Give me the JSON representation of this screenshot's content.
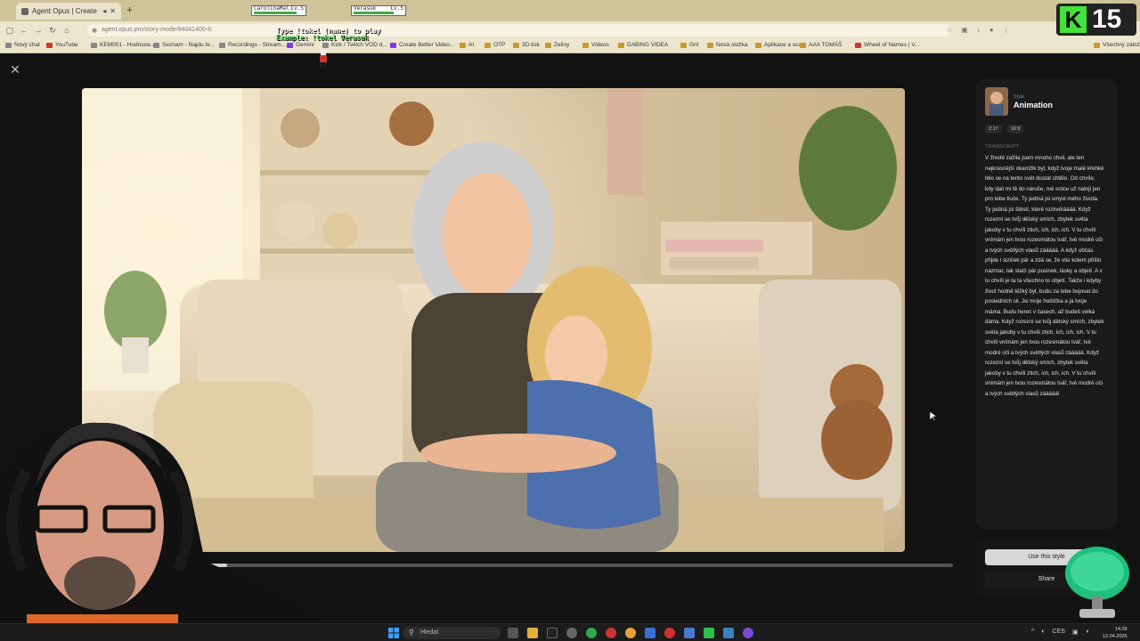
{
  "browser": {
    "tab_title": "Agent Opus | Create video",
    "url": "agent.opus.pro/story-mode/94041400-fc",
    "bookmarks": [
      "Nový chat",
      "YouTube",
      "KEM001 - Hodnoce...",
      "Seznam - Najdu te...",
      "Recordings - Stream...",
      "Gemini",
      "Kick / Twitch VOD d...",
      "Create Better Video...",
      "AI",
      "OTP",
      "3D tisk",
      "Zeliny",
      "Videos",
      "DABING VIDEA",
      "Grit",
      "Nová složka",
      "Aplikace a scan",
      "AAA TOMÁŠ",
      "Wheel of Names | V...",
      "Všechny záložky"
    ]
  },
  "stream": {
    "hp_left_name": "CarolinaMal",
    "hp_left_level": "Lv.5",
    "hp_right_name": "Verasuk",
    "hp_right_level": "Lv.5",
    "hp_left": 0.85,
    "hp_right": 0.8,
    "overlay_line1": "Type !tokel (name) to play",
    "overlay_line2": "Example: !tokel Verasuk",
    "badge_letter": "K",
    "badge_number": "15"
  },
  "panel": {
    "style_label": "Style",
    "style_name": "Animation",
    "duration": "2:17",
    "aspect": "16:9",
    "transcript_heading": "TRANSCRIPT",
    "transcript": "V životě zažila jsem mnoho chvil, ale ten nejkrásnější okamžik byl, když tvoje malé křehké tělo se na tento svět dostat chtělo. Od chvíle, kdy dali mi tě do náruče, mé srdce už nabíjí jen pro tebe tluče. Ty jediná jsi smysl mého života. Ty jediná jsi štěstí, které rozkvétáááá. Když rozezní se tvůj dětský smích, zbytek světa jakoby v tu chvíli ztich, ich, ich, ich. V tu chvíli vnímám jen tvou rozesmátou tvář, tvé modré oči a tvých světlých vlasů zááááá. A když občas přijde i slziček pár a zdá se, že vše kolem přišlo nazmar, tak stačí pár pusinek, lásky a objetí. A v tu chvíli je ta ta všechno to objetí. Takže i kdyby život hodně těžký byl, budu za tebe bojovat do posledních sil. Jsi moje holčička a já tvoje máma. Budu herec v časech, až budeš velká dáma. Když rozezní se tvůj dětský smích, zbytek světa jakoby v tu chvíli ztich, ich, ich, ich. V tu chvíli vnímám jen tvou rozesmátou tvář, tvé modré oči a tvých světlých vlasů zááááá. Když rozezní se tvůj dětský smích, zbytek světa jakoby v tu chvíli ztich, ich, ich, ich. V tu chvíli vnímám jen tvou rozesmátou tvář, tvé modré oči a tvých světlých vlasů zááááá!",
    "use_button": "Use this style",
    "share_button": "Share"
  },
  "player": {
    "progress": 0.03
  },
  "taskbar": {
    "search_placeholder": "Hledat",
    "lang": "CES",
    "time": "14:28",
    "date": "12.04.2026"
  },
  "colors": {
    "accent_green": "#44e23c",
    "background": "#121212",
    "panel": "#1a1a1a"
  }
}
